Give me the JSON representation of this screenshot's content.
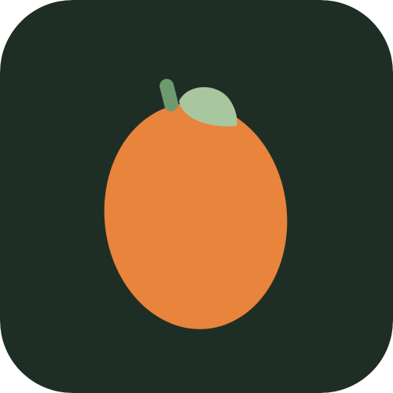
{
  "icon": {
    "name": "kumquat-app-icon",
    "depicts": "kumquat-fruit-icon",
    "colors": {
      "background": "#1f2e25",
      "fruit": "#e8843c",
      "leaf": "#a8c7a1",
      "stem": "#6e9a70"
    }
  }
}
